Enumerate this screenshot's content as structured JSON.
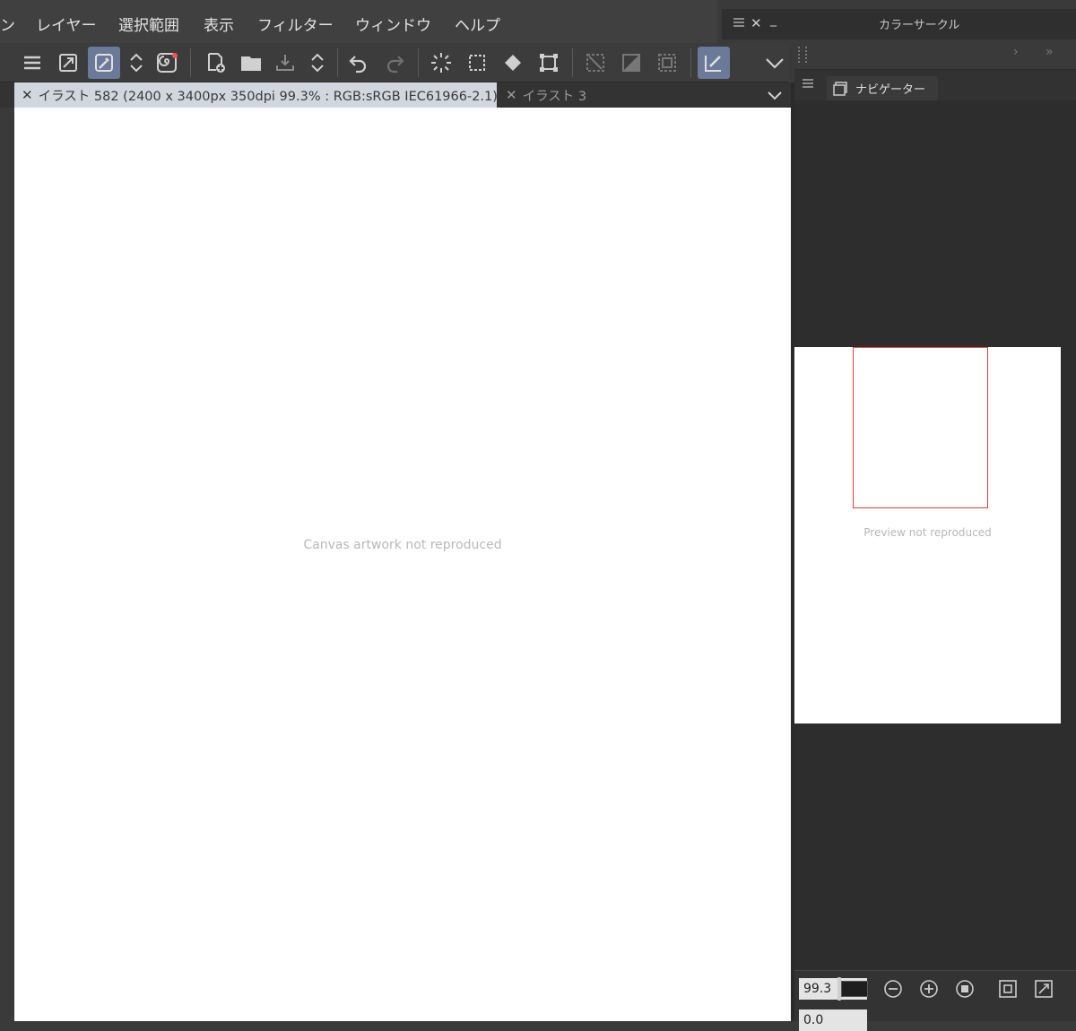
{
  "menu": {
    "items": [
      "ン",
      "レイヤー",
      "選択範囲",
      "表示",
      "フィルター",
      "ウィンドウ",
      "ヘルプ"
    ]
  },
  "toolbar": {
    "icons": [
      "menu-icon",
      "resize-icon",
      "eyedropper-icon",
      "up-down-icon",
      "spiral-icon",
      "new-file-icon",
      "open-folder-icon",
      "save-icon",
      "up-down-icon",
      "undo-icon",
      "redo-icon",
      "loading-icon",
      "select-rect-icon",
      "fill-icon",
      "transform-icon",
      "clear-selection-icon",
      "invert-selection-icon",
      "selection-border-icon",
      "checkmark-pen-icon",
      "chevron-down-icon"
    ]
  },
  "tabs": {
    "active_label": "イラスト 582 (2400 x 3400px 350dpi 99.3% : RGB:sRGB IEC61966-2.1)",
    "inactive_label": "イラスト 3"
  },
  "canvas": {
    "placeholder": "Canvas artwork not reproduced"
  },
  "color_circle": {
    "title": "カラーサークル"
  },
  "navigator": {
    "tab_label": "ナビゲーター",
    "preview_placeholder": "Preview not reproduced",
    "zoom_value": "99.3",
    "rotation_value": "0.0",
    "viewport_color": "#e03b3b"
  },
  "colors": {
    "active_tab_bg": "#d2d6df",
    "toolbar_active_bg": "#6a7a98",
    "canvas_bg": "#ffffff"
  }
}
